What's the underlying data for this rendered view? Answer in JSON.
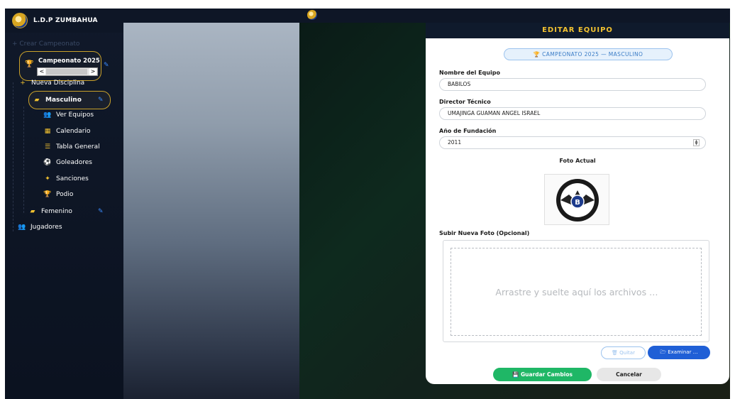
{
  "app": {
    "brand": "L.D.P ZUMBAHUA"
  },
  "sidebar": {
    "create_label": "+ Crear Campeonato",
    "championship": {
      "title": "Campeonato 2025",
      "scroll_left": "<",
      "scroll_right": ">"
    },
    "new_discipline": "Nueva Disciplina",
    "discipline_male": "Masculino",
    "items": [
      {
        "icon": "people-icon",
        "label": "Ver Equipos"
      },
      {
        "icon": "calendar-icon",
        "label": "Calendario"
      },
      {
        "icon": "table-icon",
        "label": "Tabla General"
      },
      {
        "icon": "ball-icon",
        "label": "Goleadores"
      },
      {
        "icon": "sanction-icon",
        "label": "Sanciones"
      },
      {
        "icon": "podium-icon",
        "label": "Podio"
      }
    ],
    "discipline_female": "Femenino",
    "players": "Jugadores"
  },
  "form": {
    "header": "EDITAR EQUIPO",
    "context_pill": "CAMPEONATO 2025 — MASCULINO",
    "name_label": "Nombre del Equipo",
    "name_value": "BABILOS",
    "coach_label": "Director Técnico",
    "coach_value": "UMAJINGA GUAMAN ANGEL ISRAEL",
    "year_label": "Año de Fundación",
    "year_value": "2011",
    "photo_label": "Foto Actual",
    "upload_label": "Subir Nueva Foto (Opcional)",
    "drop_text": "Arrastre y suelte aquí los archivos …",
    "remove_button": "Quitar",
    "browse_button": "Examinar …",
    "save_button": "Guardar Cambios",
    "cancel_button": "Cancelar"
  },
  "colors": {
    "accent_gold": "#f2c230",
    "primary_blue": "#1f5fd6",
    "save_green": "#1fb766"
  }
}
